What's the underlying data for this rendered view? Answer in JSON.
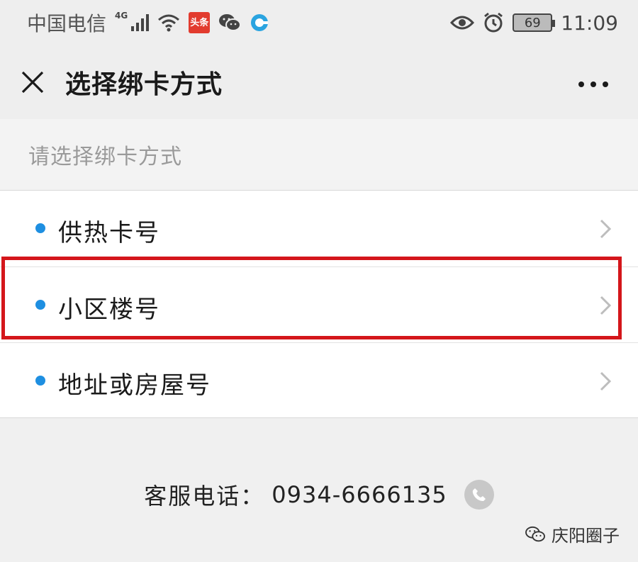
{
  "status_bar": {
    "carrier": "中国电信",
    "network": "4G",
    "app_badge": "头条",
    "battery": "69",
    "time": "11:09"
  },
  "header": {
    "title": "选择绑卡方式",
    "close_icon": "close-icon",
    "more_icon": "more-icon"
  },
  "section": {
    "label": "请选择绑卡方式"
  },
  "options": [
    {
      "label": "供热卡号"
    },
    {
      "label": "小区楼号"
    },
    {
      "label": "地址或房屋号"
    }
  ],
  "support": {
    "label": "客服电话：",
    "phone": "0934-6666135"
  },
  "watermark": {
    "text": "庆阳圈子"
  },
  "colors": {
    "accent_dot": "#1e8fe1",
    "highlight": "#d4161b"
  }
}
